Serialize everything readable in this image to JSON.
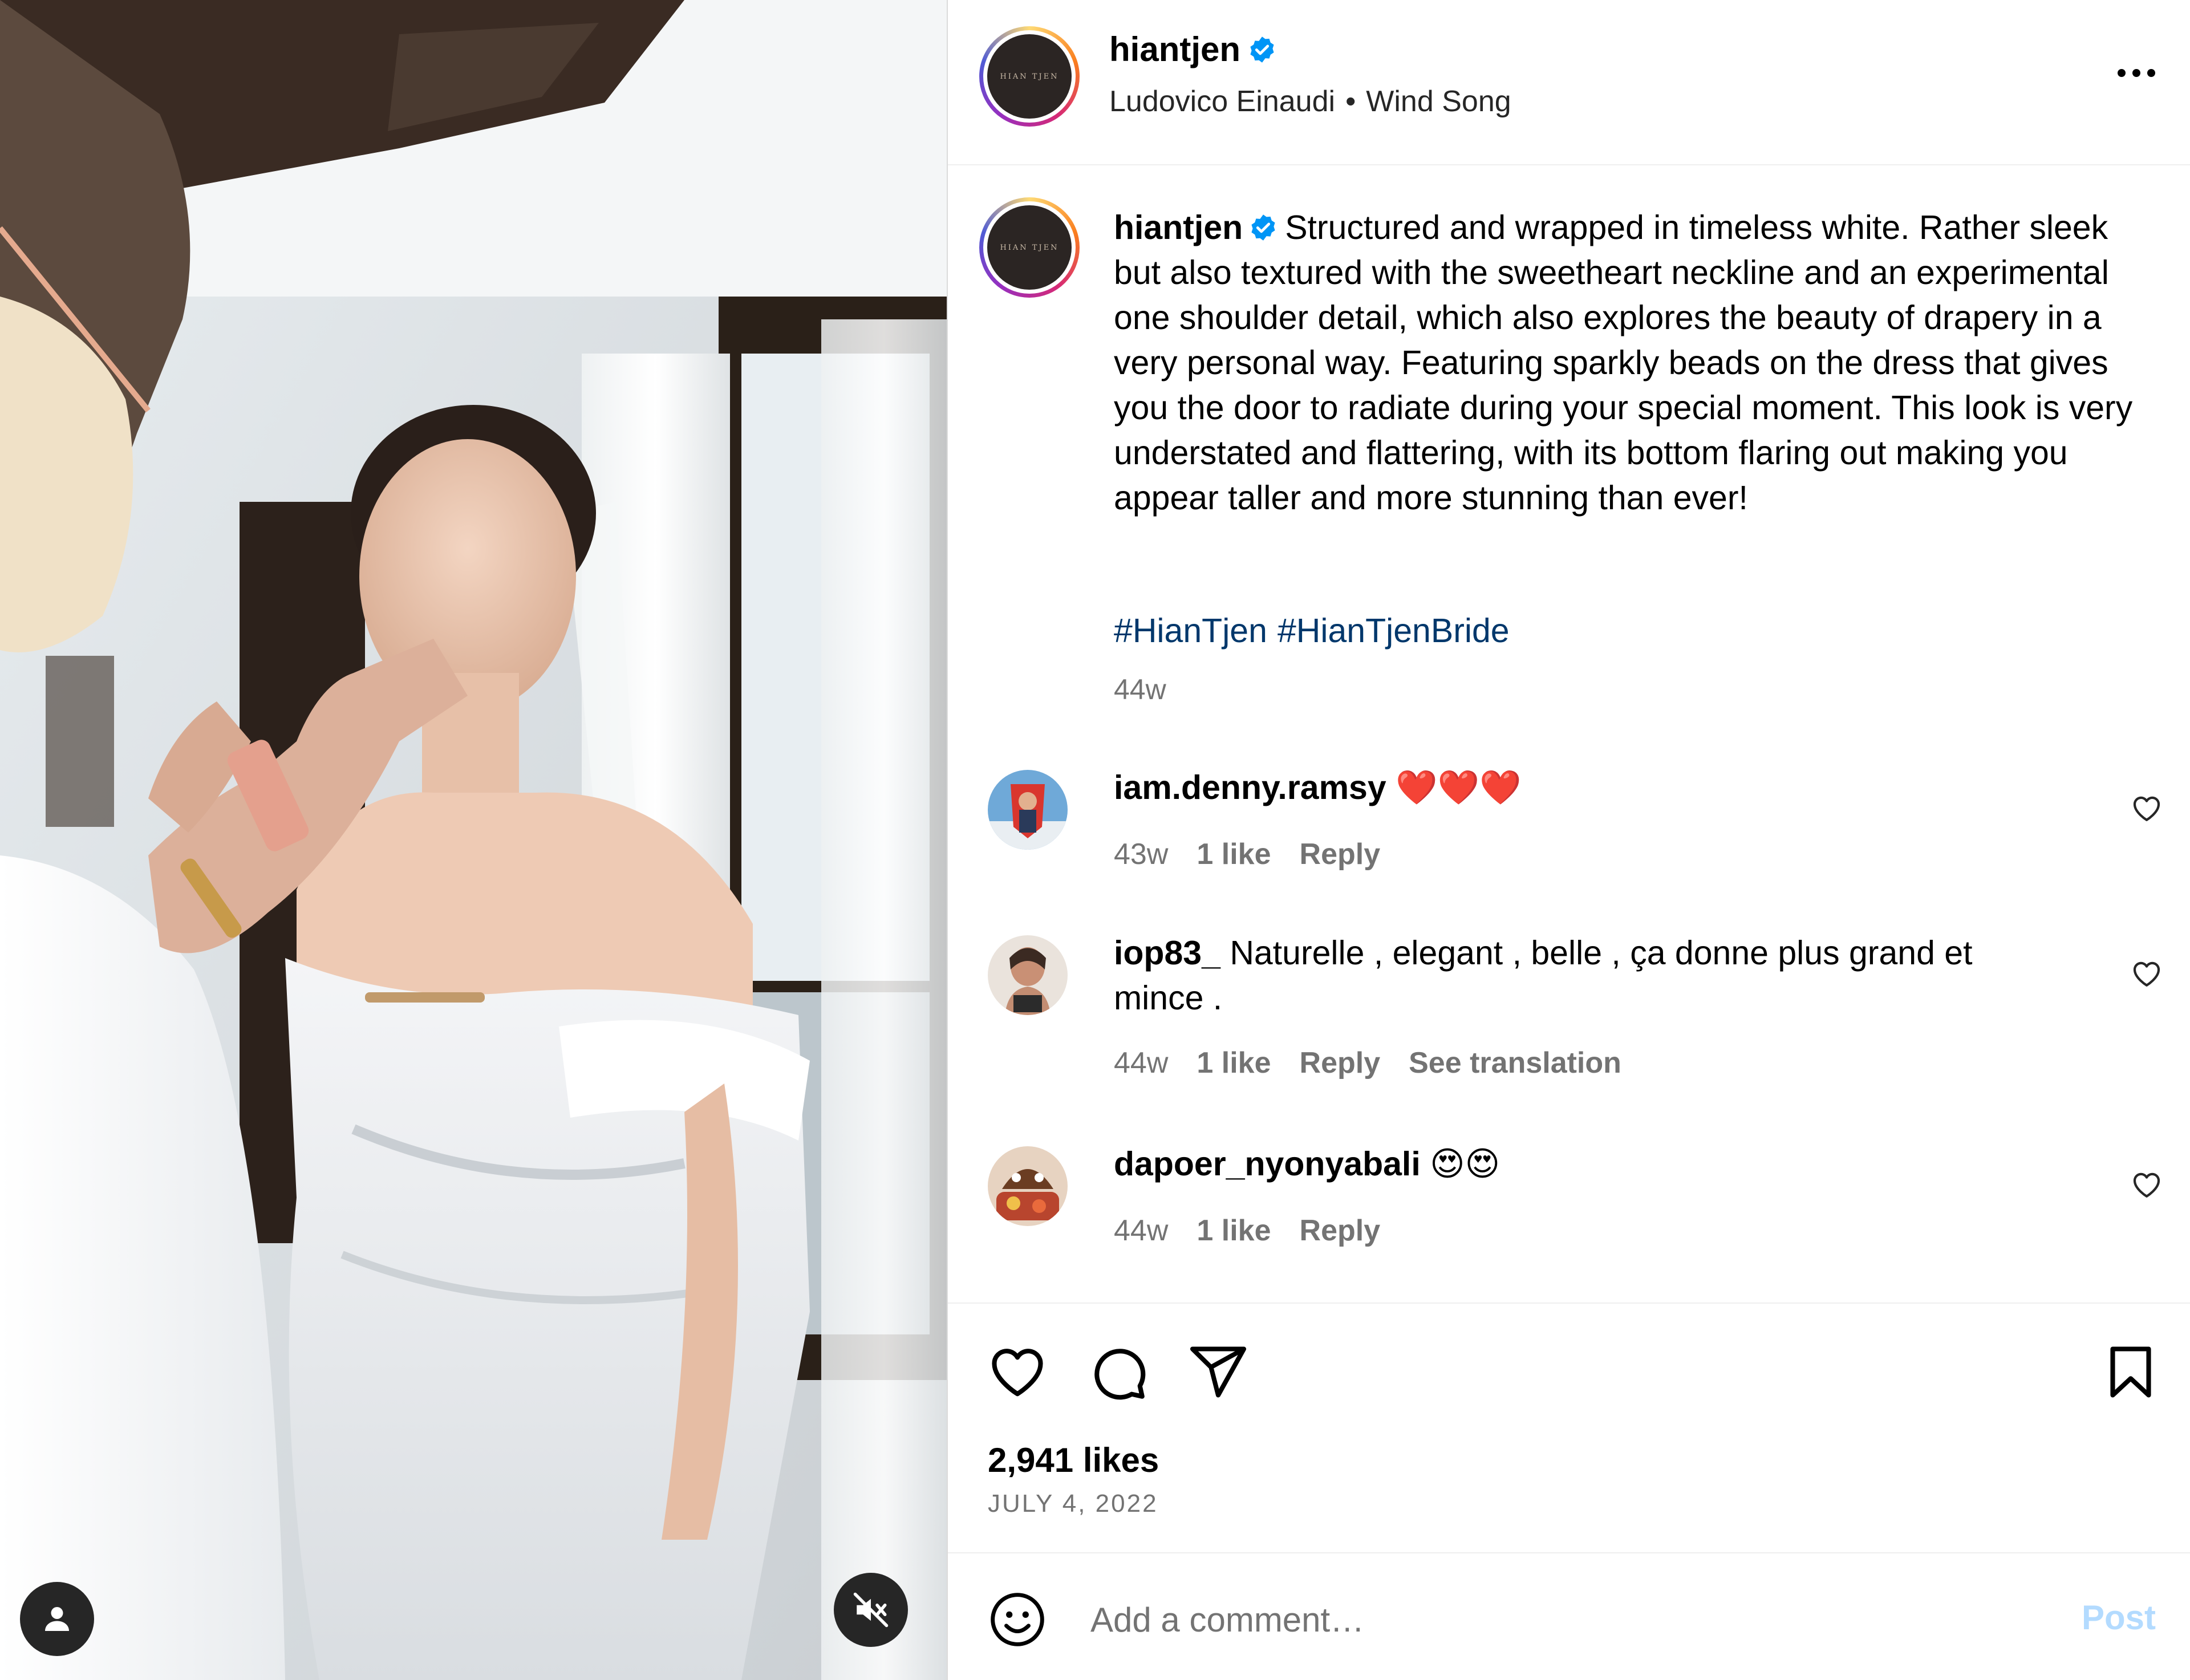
{
  "post": {
    "author": "hiantjen",
    "avatar_text": "HIAN TJEN",
    "audio_artist": "Ludovico Einaudi",
    "audio_separator": "•",
    "audio_track": "Wind Song",
    "caption": "Structured and wrapped in timeless white. Rather sleek but also textured with the sweetheart neckline and an experimental one shoulder detail, which also explores the beauty of drapery in a very personal way. Featuring sparkly beads on the dress that gives you the door to radiate during your special moment. This look is very understated and flattering, with its bottom flaring out making you appear taller and more stunning than ever!",
    "hashtags": [
      "#HianTjen",
      "#HianTjenBride"
    ],
    "caption_time": "44w",
    "likes": "2,941 likes",
    "date": "JULY 4, 2022"
  },
  "comments": [
    {
      "user": "iam.denny.ramsy",
      "text": "❤️❤️❤️",
      "time": "43w",
      "likes": "1 like",
      "reply": "Reply",
      "translate": ""
    },
    {
      "user": "iop83_",
      "text": "Naturelle , elegant , belle , ça donne plus grand et mince .",
      "time": "44w",
      "likes": "1 like",
      "reply": "Reply",
      "translate": "See translation"
    },
    {
      "user": "dapoer_nyonyabali",
      "text": "😍😍",
      "time": "44w",
      "likes": "1 like",
      "reply": "Reply",
      "translate": ""
    }
  ],
  "composer": {
    "placeholder": "Add a comment…",
    "post_label": "Post"
  },
  "icons": {
    "verified": "verified-badge-icon",
    "more": "more-options-icon",
    "like": "heart-icon",
    "comment": "comment-bubble-icon",
    "share": "paper-plane-icon",
    "save": "bookmark-icon",
    "emoji": "smiley-icon",
    "user_tag": "user-tag-icon",
    "mute": "muted-speaker-icon"
  },
  "colors": {
    "link": "#00376b",
    "verified": "#0095f6",
    "muted_text": "#737373",
    "post_button": "#b3dbff",
    "heart": "#ed4956"
  }
}
